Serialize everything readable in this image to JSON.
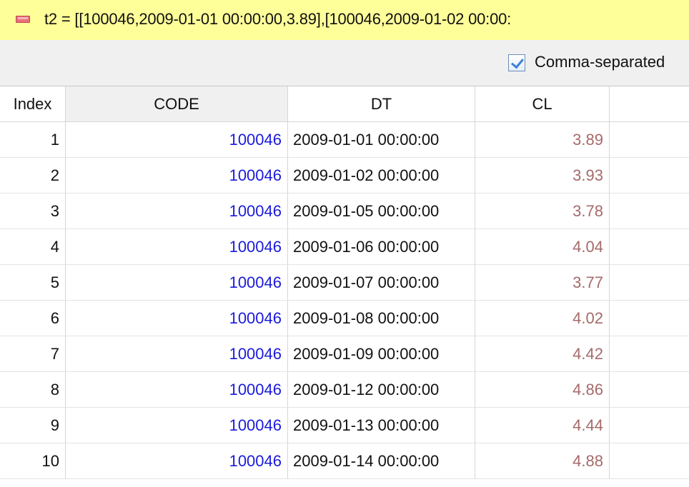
{
  "header": {
    "variable_text": "t2 = [[100046,2009-01-01 00:00:00,3.89],[100046,2009-01-02 00:00:"
  },
  "toolbar": {
    "comma_separated_label": "Comma-separated",
    "comma_separated_checked": true
  },
  "table": {
    "columns": [
      "Index",
      "CODE",
      "DT",
      "CL"
    ],
    "rows": [
      {
        "index": "1",
        "code": "100046",
        "dt": "2009-01-01 00:00:00",
        "cl": "3.89"
      },
      {
        "index": "2",
        "code": "100046",
        "dt": "2009-01-02 00:00:00",
        "cl": "3.93"
      },
      {
        "index": "3",
        "code": "100046",
        "dt": "2009-01-05 00:00:00",
        "cl": "3.78"
      },
      {
        "index": "4",
        "code": "100046",
        "dt": "2009-01-06 00:00:00",
        "cl": "4.04"
      },
      {
        "index": "5",
        "code": "100046",
        "dt": "2009-01-07 00:00:00",
        "cl": "3.77"
      },
      {
        "index": "6",
        "code": "100046",
        "dt": "2009-01-08 00:00:00",
        "cl": "4.02"
      },
      {
        "index": "7",
        "code": "100046",
        "dt": "2009-01-09 00:00:00",
        "cl": "4.42"
      },
      {
        "index": "8",
        "code": "100046",
        "dt": "2009-01-12 00:00:00",
        "cl": "4.86"
      },
      {
        "index": "9",
        "code": "100046",
        "dt": "2009-01-13 00:00:00",
        "cl": "4.44"
      },
      {
        "index": "10",
        "code": "100046",
        "dt": "2009-01-14 00:00:00",
        "cl": "4.88"
      }
    ]
  },
  "colors": {
    "header_bg": "#ffff99",
    "code_text": "#1a1adb",
    "cl_text": "#a66a6a"
  },
  "icons": {
    "collapse": "collapse-minus-icon",
    "checkbox": "checkmark-icon"
  }
}
